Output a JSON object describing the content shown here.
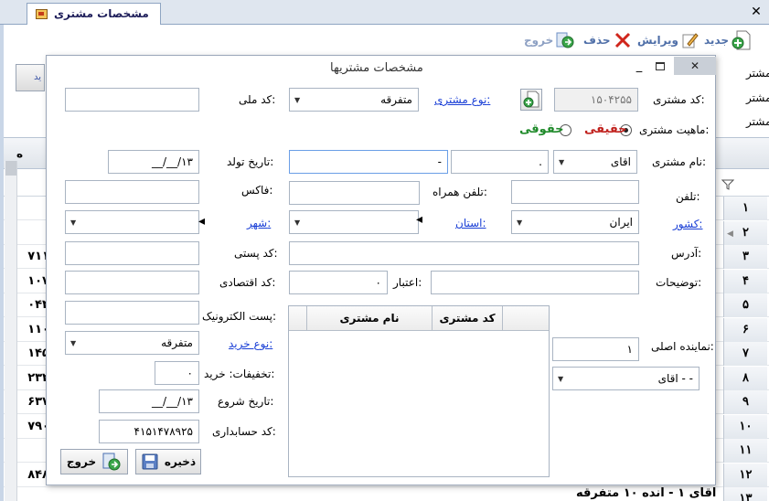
{
  "outer": {
    "tab_title": "مشخصات مشتری",
    "close_glyph": "✕",
    "toolbar": {
      "new_label": "جدید",
      "edit_label": "ویرایش",
      "delete_label": "حذف",
      "exit_label": "خروج"
    },
    "bg_labels": [
      "کد مشتر",
      "نام مشتر",
      "کد مشتر"
    ],
    "bg_button_text": "ید",
    "grid": {
      "header_left": "ه",
      "row_numbers": [
        "۱",
        "۲",
        "۳",
        "۴",
        "۵",
        "۶",
        "۷",
        "۸",
        "۹",
        "۱۰",
        "۱۱",
        "۱۲"
      ],
      "left_values": [
        "",
        "",
        "۷۱۱",
        "۱۰۷",
        "۰۴۴",
        "۱۱۰",
        "۱۴۵",
        "۲۳۲",
        "۶۳۷",
        "۷۹۰",
        "",
        "۸۴۸"
      ],
      "bottom_row_text": "اقای  ۱ - انده  ۱۰  متفرقه",
      "bottom_row_num": "۱۳"
    }
  },
  "dialog": {
    "title": "مشخصات مشتریها",
    "min_glyph": "_",
    "close_glyph": "✕",
    "customer_code_label": "کد مشتری:",
    "customer_code_value": "۱۵۰۴۲۵۵",
    "customer_type_label": "نوع مشتری:",
    "customer_type_value": "متفرقه",
    "national_code_label": "کد ملی:",
    "national_code_value": "",
    "nature_label": "ماهیت مشتری:",
    "nature_real": "حقیقی",
    "nature_legal": "حقوقی",
    "customer_name_label": "نام مشتری:",
    "title_value": "اقای",
    "first_name_value": ".",
    "last_name_value": "-",
    "birth_date_label": "تاریخ تولد:",
    "birth_date_value": "__/__/۱۳",
    "phone_label": "تلفن:",
    "phone_value": "",
    "mobile_label": "تلفن همراه:",
    "mobile_value": "",
    "fax_label": "فاکس:",
    "fax_value": "",
    "country_label": "کشور:",
    "country_value": "ایران",
    "province_label": "استان:",
    "province_value": "",
    "city_label": "شهر:",
    "city_value": "",
    "address_label": "آدرس:",
    "address_value": "",
    "postal_code_label": "کد پستی:",
    "postal_code_value": "",
    "notes_label": "توضیحات:",
    "notes_value": "",
    "credit_label": "اعتبار:",
    "credit_value": "۰",
    "economic_code_label": "کد اقتصادی:",
    "economic_code_value": "",
    "email_label": "پست الکترونیک:",
    "email_value": "",
    "purchase_type_label": "نوع خرید:",
    "purchase_type_value": "متفرقه",
    "discount_label": "تخفیفات: خرید:",
    "discount_value": "۰",
    "start_date_label": "تاریخ شروع:",
    "start_date_value": "__/__/۱۳",
    "account_code_label": "کد حسابداری:",
    "account_code_value": "۴۱۵۱۴۷۸۹۲۵",
    "main_rep_label": "نماینده اصلی:",
    "main_rep_value": "۱",
    "rep_name_value": "اقای - -",
    "grid_col_code": "کد مشتری",
    "grid_col_name": "نام مشتری",
    "save_label": "ذخیره",
    "exit_label": "خروج"
  },
  "colors": {
    "link": "#1a3fd6",
    "real_label": "#c0201c",
    "legal_label": "#1f8a2a",
    "toolbar_text": "#4f6fa8"
  }
}
